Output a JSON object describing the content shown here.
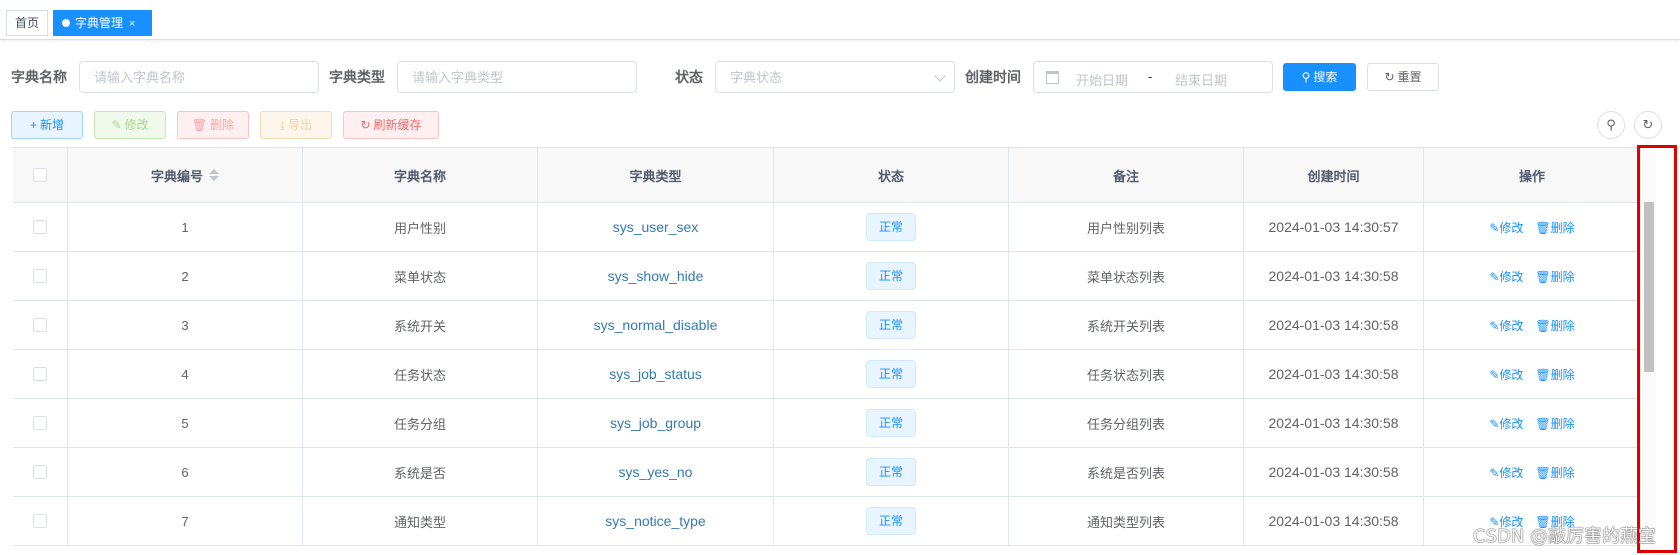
{
  "tags": {
    "home": "首页",
    "active": "字典管理",
    "close": "×"
  },
  "search": {
    "dict_name_label": "字典名称",
    "dict_name_placeholder": "请输入字典名称",
    "dict_type_label": "字典类型",
    "dict_type_placeholder": "请输入字典类型",
    "status_label": "状态",
    "status_placeholder": "字典状态",
    "created_label": "创建时间",
    "start_placeholder": "开始日期",
    "separator": "-",
    "end_placeholder": "结束日期",
    "search_btn": "搜索",
    "reset_btn": "重置"
  },
  "toolbar": {
    "add": "新增",
    "edit": "修改",
    "delete": "删除",
    "export": "导出",
    "refresh_cache": "刷新缓存"
  },
  "table": {
    "headers": [
      "字典编号",
      "字典名称",
      "字典类型",
      "状态",
      "备注",
      "创建时间",
      "操作"
    ],
    "rows": [
      {
        "id": "1",
        "name": "用户性别",
        "type": "sys_user_sex",
        "status": "正常",
        "remark": "用户性别列表",
        "created": "2024-01-03 14:30:57"
      },
      {
        "id": "2",
        "name": "菜单状态",
        "type": "sys_show_hide",
        "status": "正常",
        "remark": "菜单状态列表",
        "created": "2024-01-03 14:30:58"
      },
      {
        "id": "3",
        "name": "系统开关",
        "type": "sys_normal_disable",
        "status": "正常",
        "remark": "系统开关列表",
        "created": "2024-01-03 14:30:58"
      },
      {
        "id": "4",
        "name": "任务状态",
        "type": "sys_job_status",
        "status": "正常",
        "remark": "任务状态列表",
        "created": "2024-01-03 14:30:58"
      },
      {
        "id": "5",
        "name": "任务分组",
        "type": "sys_job_group",
        "status": "正常",
        "remark": "任务分组列表",
        "created": "2024-01-03 14:30:58"
      },
      {
        "id": "6",
        "name": "系统是否",
        "type": "sys_yes_no",
        "status": "正常",
        "remark": "系统是否列表",
        "created": "2024-01-03 14:30:58"
      },
      {
        "id": "7",
        "name": "通知类型",
        "type": "sys_notice_type",
        "status": "正常",
        "remark": "通知类型列表",
        "created": "2024-01-03 14:30:58"
      }
    ],
    "op_edit": "修改",
    "op_delete": "删除"
  },
  "watermark": "CSDN @敲厉害的燕宝",
  "colors": {
    "primary": "#1890ff",
    "highlight": "#e00000"
  }
}
